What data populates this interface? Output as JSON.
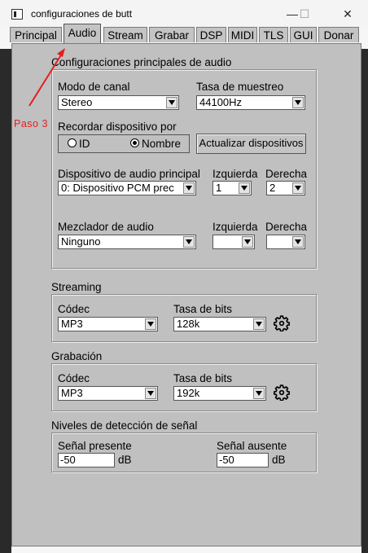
{
  "window": {
    "title": "configuraciones de butt"
  },
  "titlebar_buttons": {
    "min": "—",
    "max": "☐",
    "close": "✕"
  },
  "tabs": [
    {
      "label": "Principal"
    },
    {
      "label": "Audio"
    },
    {
      "label": "Stream"
    },
    {
      "label": "Grabar"
    },
    {
      "label": "DSP"
    },
    {
      "label": "MIDI"
    },
    {
      "label": "TLS"
    },
    {
      "label": "GUI"
    },
    {
      "label": "Donar"
    }
  ],
  "main_audio": {
    "title": "Configuraciones principales de audio",
    "channel_mode_label": "Modo de canal",
    "channel_mode_value": "Stereo",
    "sample_rate_label": "Tasa de muestreo",
    "sample_rate_value": "44100Hz",
    "remember_device_label": "Recordar dispositivo por",
    "radio_id": "ID",
    "radio_name": "Nombre",
    "radio_selected": "Nombre",
    "update_devices_button": "Actualizar dispositivos",
    "main_device_label": "Dispositivo de audio principal",
    "main_device_value": "0: Dispositivo PCM prec",
    "left_label": "Izquierda",
    "right_label": "Derecha",
    "main_left_value": "1",
    "main_right_value": "2",
    "mixer_label": "Mezclador de audio",
    "mixer_value": "Ninguno",
    "mixer_left_value": "",
    "mixer_right_value": ""
  },
  "streaming": {
    "title": "Streaming",
    "codec_label": "Códec",
    "codec_value": "MP3",
    "bitrate_label": "Tasa de bits",
    "bitrate_value": "128k"
  },
  "recording": {
    "title": "Grabación",
    "codec_label": "Códec",
    "codec_value": "MP3",
    "bitrate_label": "Tasa de bits",
    "bitrate_value": "192k"
  },
  "signal": {
    "title": "Niveles de detección de señal",
    "present_label": "Señal presente",
    "present_value": "-50",
    "absent_label": "Señal ausente",
    "absent_value": "-50",
    "unit": "dB"
  },
  "annotation": {
    "text": "Paso 3",
    "color": "#e02020"
  },
  "icons": {
    "settings": "gear-icon"
  }
}
